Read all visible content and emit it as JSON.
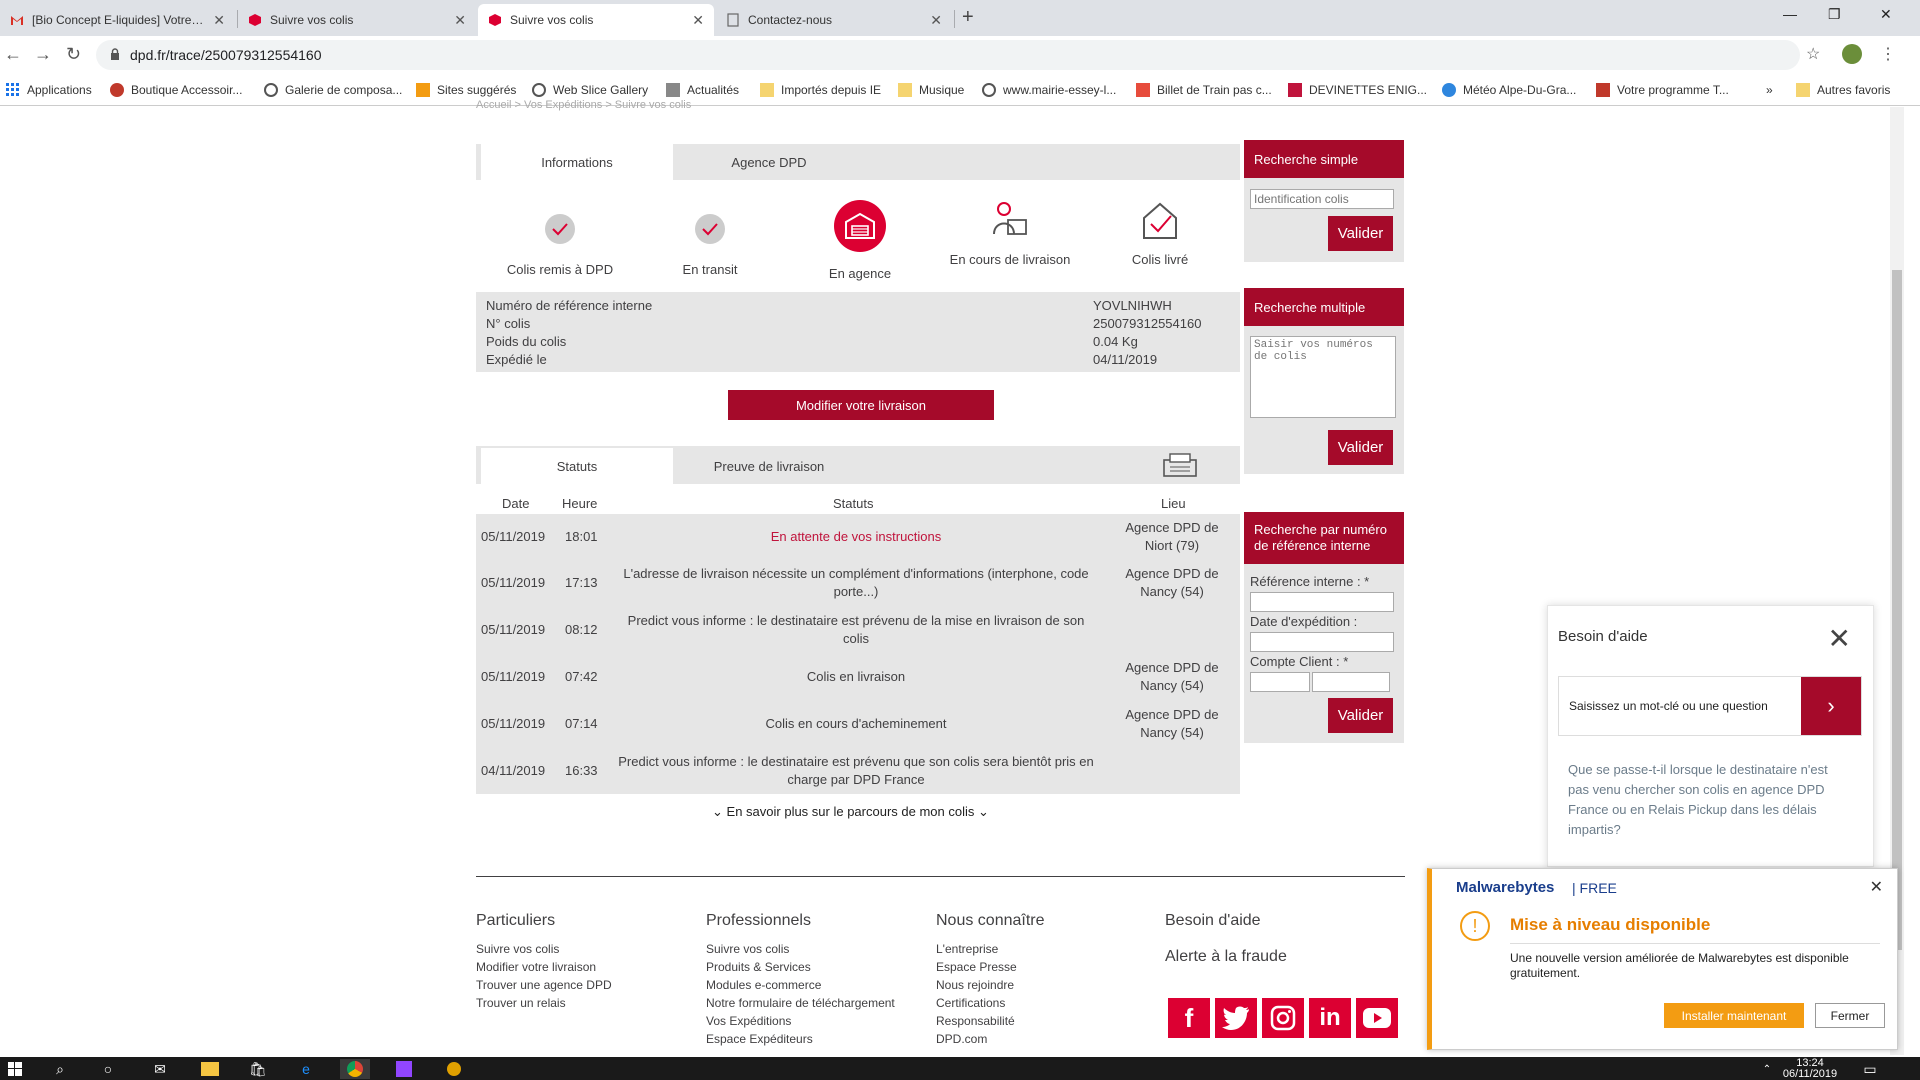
{
  "browser": {
    "tabs": [
      {
        "label": "[Bio Concept E-liquides] Votre co",
        "icon": "gmail-icon"
      },
      {
        "label": "Suivre vos colis",
        "icon": "dpd-icon"
      },
      {
        "label": "Suivre vos colis",
        "icon": "dpd-icon"
      },
      {
        "label": "Contactez-nous",
        "icon": "page-icon"
      }
    ],
    "url": "dpd.fr/trace/250079312554160",
    "bookmarks": [
      "Applications",
      "Boutique Accessoir...",
      "Galerie de composa...",
      "Sites suggérés",
      "Web Slice Gallery",
      "Actualités",
      "Importés depuis IE",
      "Musique",
      "www.mairie-essey-l...",
      "Billet de Train pas c...",
      "DEVINETTES ENIG...",
      "Météo Alpe-Du-Gra...",
      "Votre programme T..."
    ],
    "bookmarks_more": "»",
    "other_bookmarks": "Autres favoris"
  },
  "breadcrumb": "Accueil > Vos Expéditions > Suivre vos colis",
  "info_tabs": {
    "informations": "Informations",
    "agence": "Agence DPD"
  },
  "steps": [
    "Colis remis à DPD",
    "En transit",
    "En agence",
    "En cours de livraison",
    "Colis livré"
  ],
  "details": {
    "labels": [
      "Numéro de référence interne",
      "N° colis",
      "Poids du colis",
      "Expédié le"
    ],
    "values": [
      "YOVLNIHWH",
      "250079312554160",
      "0.04 Kg",
      "04/11/2019"
    ]
  },
  "modify_button": "Modifier votre livraison",
  "status_tabs": {
    "statuts": "Statuts",
    "preuve": "Preuve de livraison"
  },
  "table": {
    "headers": [
      "Date",
      "Heure",
      "Statuts",
      "Lieu"
    ],
    "rows": [
      {
        "date": "05/11/2019",
        "heure": "18:01",
        "statut": "En attente de vos instructions",
        "lieu": "Agence DPD de Niort (79)"
      },
      {
        "date": "05/11/2019",
        "heure": "17:13",
        "statut": "L'adresse de livraison nécessite un complément d'informations (interphone, code porte...)",
        "lieu": "Agence DPD de Nancy (54)"
      },
      {
        "date": "05/11/2019",
        "heure": "08:12",
        "statut": "Predict vous informe : le destinataire est prévenu de la mise en livraison de son colis",
        "lieu": ""
      },
      {
        "date": "05/11/2019",
        "heure": "07:42",
        "statut": "Colis en livraison",
        "lieu": "Agence DPD de Nancy (54)"
      },
      {
        "date": "05/11/2019",
        "heure": "07:14",
        "statut": "Colis en cours d'acheminement",
        "lieu": "Agence DPD de Nancy (54)"
      },
      {
        "date": "04/11/2019",
        "heure": "16:33",
        "statut": "Predict vous informe : le destinataire est prévenu que son colis sera bientôt pris en charge par DPD France",
        "lieu": ""
      }
    ]
  },
  "more_link": "En savoir plus sur le parcours de mon colis",
  "sidebar": {
    "simple_title": "Recherche simple",
    "simple_placeholder": "Identification colis",
    "valider": "Valider",
    "multiple_title": "Recherche multiple",
    "multiple_placeholder": "Saisir vos numéros de colis",
    "ref_title": "Recherche par numéro de référence interne",
    "ref_label": "Référence interne : *",
    "date_label": "Date d'expédition :",
    "compte_label": "Compte Client : *"
  },
  "footer": {
    "particuliers": {
      "title": "Particuliers",
      "links": [
        "Suivre vos colis",
        "Modifier votre livraison",
        "Trouver une agence DPD",
        "Trouver un relais"
      ]
    },
    "professionnels": {
      "title": "Professionnels",
      "links": [
        "Suivre vos colis",
        "Produits & Services",
        "Modules e-commerce",
        "Notre formulaire de téléchargement",
        "Vos Expéditions",
        "Espace Expéditeurs"
      ]
    },
    "nous": {
      "title": "Nous connaître",
      "links": [
        "L'entreprise",
        "Espace Presse",
        "Nous rejoindre",
        "Certifications",
        "Responsabilité",
        "DPD.com"
      ]
    },
    "aide": "Besoin d'aide",
    "fraude": "Alerte à la fraude",
    "social": [
      "f",
      "t",
      "ig",
      "in",
      "yt"
    ]
  },
  "help_widget": {
    "title": "Besoin d'aide",
    "search_label": "Saisissez un mot-clé ou une question",
    "question": "Que se passe-t-il lorsque le destinataire n'est pas venu chercher son colis en agence DPD France ou en Relais Pickup dans les délais impartis?"
  },
  "malwarebytes": {
    "brand": "Malwarebytes",
    "edition": "| FREE",
    "title": "Mise à niveau disponible",
    "message": "Une nouvelle version améliorée de Malwarebytes est disponible gratuitement.",
    "install": "Installer maintenant",
    "close": "Fermer"
  },
  "taskbar": {
    "time": "13:24",
    "date": "06/11/2019"
  },
  "colors": {
    "dpd_red": "#dc0032",
    "dpd_crimson": "#a50a2a",
    "malwarebytes_orange": "#f39c12"
  }
}
